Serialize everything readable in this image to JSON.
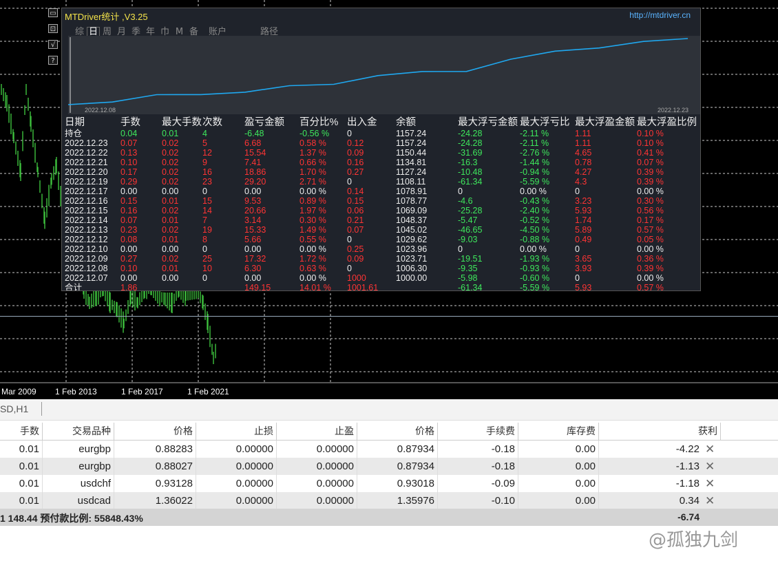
{
  "chart": {
    "x_labels": [
      "Mar 2009",
      "1 Feb 2013",
      "1 Feb 2017",
      "1 Feb 2021"
    ],
    "side_buttons": [
      "minimize-icon",
      "restore-icon",
      "check-icon",
      "help-icon"
    ],
    "side_button_glyphs": [
      "▭",
      "⊡",
      "√",
      "?"
    ]
  },
  "panel": {
    "title": "MTDriver统计 ,V3.25",
    "url": "http://mtdriver.cn",
    "tabs": [
      "综",
      "日",
      "周",
      "月",
      "季",
      "年",
      "巾",
      "M",
      "备",
      "账户"
    ],
    "active_tab": "日",
    "extra_tab": "路径",
    "equity_start_date": "2022.12.08",
    "equity_end_date": "2022.12.23",
    "columns": [
      "日期",
      "手数",
      "最大手数",
      "次数",
      "盈亏金额",
      "百分比%",
      "出入金",
      "余额",
      "最大浮亏金额",
      "最大浮亏比",
      "最大浮盈金额",
      "最大浮盈比例"
    ],
    "rows": [
      [
        "持仓",
        "0.04",
        "0.01",
        "4",
        "-6.48",
        "-0.56 %",
        "0",
        "1157.24",
        "-24.28",
        "-2.11 %",
        "1.11",
        "0.10 %"
      ],
      [
        "2022.12.23",
        "0.07",
        "0.02",
        "5",
        "6.68",
        "0.58 %",
        "0.12",
        "1157.24",
        "-24.28",
        "-2.11 %",
        "1.11",
        "0.10 %"
      ],
      [
        "2022.12.22",
        "0.13",
        "0.02",
        "12",
        "15.54",
        "1.37 %",
        "0.09",
        "1150.44",
        "-31.69",
        "-2.76 %",
        "4.65",
        "0.41 %"
      ],
      [
        "2022.12.21",
        "0.10",
        "0.02",
        "9",
        "7.41",
        "0.66 %",
        "0.16",
        "1134.81",
        "-16.3",
        "-1.44 %",
        "0.78",
        "0.07 %"
      ],
      [
        "2022.12.20",
        "0.17",
        "0.02",
        "16",
        "18.86",
        "1.70 %",
        "0.27",
        "1127.24",
        "-10.48",
        "-0.94 %",
        "4.27",
        "0.39 %"
      ],
      [
        "2022.12.19",
        "0.29",
        "0.02",
        "23",
        "29.20",
        "2.71 %",
        "0",
        "1108.11",
        "-61.34",
        "-5.59 %",
        "4.3",
        "0.39 %"
      ],
      [
        "2022.12.17",
        "0.00",
        "0.00",
        "0",
        "0.00",
        "0.00 %",
        "0.14",
        "1078.91",
        "0",
        "0.00 %",
        "0",
        "0.00 %"
      ],
      [
        "2022.12.16",
        "0.15",
        "0.01",
        "15",
        "9.53",
        "0.89 %",
        "0.15",
        "1078.77",
        "-4.6",
        "-0.43 %",
        "3.23",
        "0.30 %"
      ],
      [
        "2022.12.15",
        "0.16",
        "0.02",
        "14",
        "20.66",
        "1.97 %",
        "0.06",
        "1069.09",
        "-25.28",
        "-2.40 %",
        "5.93",
        "0.56 %"
      ],
      [
        "2022.12.14",
        "0.07",
        "0.01",
        "7",
        "3.14",
        "0.30 %",
        "0.21",
        "1048.37",
        "-5.47",
        "-0.52 %",
        "1.74",
        "0.17 %"
      ],
      [
        "2022.12.13",
        "0.23",
        "0.02",
        "19",
        "15.33",
        "1.49 %",
        "0.07",
        "1045.02",
        "-46.65",
        "-4.50 %",
        "5.89",
        "0.57 %"
      ],
      [
        "2022.12.12",
        "0.08",
        "0.01",
        "8",
        "5.66",
        "0.55 %",
        "0",
        "1029.62",
        "-9.03",
        "-0.88 %",
        "0.49",
        "0.05 %"
      ],
      [
        "2022.12.10",
        "0.00",
        "0.00",
        "0",
        "0.00",
        "0.00 %",
        "0.25",
        "1023.96",
        "0",
        "0.00 %",
        "0",
        "0.00 %"
      ],
      [
        "2022.12.09",
        "0.27",
        "0.02",
        "25",
        "17.32",
        "1.72 %",
        "0.09",
        "1023.71",
        "-19.51",
        "-1.93 %",
        "3.65",
        "0.36 %"
      ],
      [
        "2022.12.08",
        "0.10",
        "0.01",
        "10",
        "6.30",
        "0.63 %",
        "0",
        "1006.30",
        "-9.35",
        "-0.93 %",
        "3.93",
        "0.39 %"
      ],
      [
        "2022.12.07",
        "0.00",
        "0.00",
        "0",
        "0.00",
        "0.00 %",
        "1000",
        "1000.00",
        "-5.98",
        "-0.60 %",
        "0",
        "0.00 %"
      ]
    ],
    "total": [
      "合计",
      "1.86",
      "",
      "",
      "149.15",
      "14.01 %",
      "1001.61",
      "",
      "-61.34",
      "-5.59 %",
      "5.93",
      "0.57 %"
    ],
    "colors": {
      "positive": "#ff3434",
      "negative": "#3ee85c",
      "neutral": "#eeeeee",
      "title": "#f4e44a",
      "url": "#5ab4ff",
      "equity_line": "#1fa8f0"
    }
  },
  "tab_strip": {
    "label": "SD,H1"
  },
  "orders": {
    "columns": [
      "手数",
      "交易品种",
      "价格",
      "止损",
      "止盈",
      "价格",
      "手续费",
      "库存费",
      "获利"
    ],
    "rows": [
      [
        "0.01",
        "eurgbp",
        "0.88283",
        "0.00000",
        "0.00000",
        "0.87934",
        "-0.18",
        "0.00",
        "-4.22"
      ],
      [
        "0.01",
        "eurgbp",
        "0.88027",
        "0.00000",
        "0.00000",
        "0.87934",
        "-0.18",
        "0.00",
        "-1.13"
      ],
      [
        "0.01",
        "usdchf",
        "0.93128",
        "0.00000",
        "0.00000",
        "0.93018",
        "-0.09",
        "0.00",
        "-1.18"
      ],
      [
        "0.01",
        "usdcad",
        "1.36022",
        "0.00000",
        "0.00000",
        "1.35976",
        "-0.10",
        "0.00",
        "0.34"
      ]
    ],
    "close_glyph": "✕"
  },
  "summary": {
    "left": "1 148.44  预付款比例: 55848.43%",
    "right": "-6.74"
  },
  "watermark": "@孤独九剑"
}
